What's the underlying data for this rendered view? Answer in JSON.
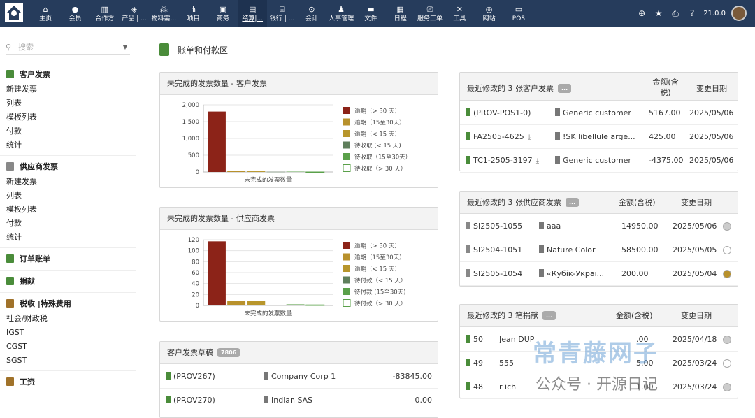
{
  "topnav": {
    "items": [
      {
        "label": "主页",
        "icon": "home-icon",
        "glyph": "⌂"
      },
      {
        "label": "会员",
        "icon": "user-icon",
        "glyph": "●"
      },
      {
        "label": "合作方",
        "icon": "building-icon",
        "glyph": "▥"
      },
      {
        "label": "产品 | ...",
        "icon": "cube-icon",
        "glyph": "◈"
      },
      {
        "label": "物料需...",
        "icon": "cubes-icon",
        "glyph": "⁂"
      },
      {
        "label": "项目",
        "icon": "project-icon",
        "glyph": "⋔"
      },
      {
        "label": "商务",
        "icon": "briefcase-icon",
        "glyph": "▣"
      },
      {
        "label": "结算|...",
        "icon": "invoice-icon",
        "glyph": "▤"
      },
      {
        "label": "银行 | ...",
        "icon": "bank-icon",
        "glyph": "⌸"
      },
      {
        "label": "会计",
        "icon": "search-money-icon",
        "glyph": "⊙"
      },
      {
        "label": "人事管理",
        "icon": "people-icon",
        "glyph": "♟"
      },
      {
        "label": "文件",
        "icon": "folder-icon",
        "glyph": "▬"
      },
      {
        "label": "日程",
        "icon": "calendar-icon",
        "glyph": "▦"
      },
      {
        "label": "服务工单",
        "icon": "ticket-icon",
        "glyph": "⎚"
      },
      {
        "label": "工具",
        "icon": "tools-icon",
        "glyph": "✕"
      },
      {
        "label": "网站",
        "icon": "globe-icon",
        "glyph": "◎"
      },
      {
        "label": "POS",
        "icon": "pos-icon",
        "glyph": "▭"
      }
    ],
    "version": "21.0.0"
  },
  "sidebar": {
    "search_placeholder": "搜索",
    "customer_invoices": {
      "title": "客户发票",
      "items": [
        "新建发票",
        "列表",
        "模板列表",
        "付款",
        "统计"
      ]
    },
    "supplier_invoices": {
      "title": "供应商发票",
      "items": [
        "新建发票",
        "列表",
        "模板列表",
        "付款",
        "统计"
      ]
    },
    "order_billing": "订单账单",
    "donations": "捐献",
    "tax": {
      "title": "税收 |特殊费用",
      "items": [
        "社会/财政税",
        "IGST",
        "CGST",
        "SGST"
      ]
    },
    "salary": "工资"
  },
  "page": {
    "title": "账单和付款区"
  },
  "customer_chart": {
    "title": "未完成的发票数量 - 客户发票",
    "xlabel": "未完成的发票数量",
    "ticks": [
      "2,000",
      "1,500",
      "1,000",
      "500",
      "0"
    ],
    "legend": [
      "逾期（> 30 天）",
      "逾期（15至30天）",
      "逾期（< 15 天）",
      "待收取 (< 15 天)",
      "待收取（15至30天）",
      "待收取（> 30 天）"
    ]
  },
  "supplier_chart": {
    "title": "未完成的发票数量 - 供应商发票",
    "xlabel": "未完成的发票数量",
    "ticks": [
      "120",
      "100",
      "80",
      "60",
      "40",
      "20",
      "0"
    ],
    "legend": [
      "逾期（> 30 天）",
      "逾期（15至30天）",
      "逾期（< 15 天）",
      "待付款（< 15 天）",
      "待付款 (15至30天)",
      "待付款（> 30 天）"
    ]
  },
  "chart_data": [
    {
      "type": "bar",
      "title": "未完成的发票数量 - 客户发票",
      "xlabel": "未完成的发票数量",
      "ylim": [
        0,
        2000
      ],
      "categories": [
        "逾期（> 30 天）",
        "逾期（15至30天）",
        "逾期（< 15 天）",
        "待收取 (< 15 天)",
        "待收取（15至30天）",
        "待收取（> 30 天）"
      ],
      "values": [
        1800,
        25,
        20,
        5,
        10,
        0
      ],
      "colors": [
        "#8c2318",
        "#b8912c",
        "#b8962c",
        "#5f7f5c",
        "#5aa04a",
        "#ffffff"
      ]
    },
    {
      "type": "bar",
      "title": "未完成的发票数量 - 供应商发票",
      "xlabel": "未完成的发票数量",
      "ylim": [
        0,
        120
      ],
      "categories": [
        "逾期（> 30 天）",
        "逾期（15至30天）",
        "逾期（< 15 天）",
        "待付款（< 15 天）",
        "待付款 (15至30天)",
        "待付款（> 30 天）"
      ],
      "values": [
        117,
        8,
        8,
        1,
        2,
        1
      ],
      "colors": [
        "#8c2318",
        "#b8912c",
        "#b8962c",
        "#5f7f5c",
        "#5aa04a",
        "#ffffff"
      ]
    }
  ],
  "drafts": {
    "title": "客户发票草稿",
    "count": "7806",
    "rows": [
      {
        "ref": "(PROV267)",
        "company": "Company Corp 1",
        "amount": "-83845.00"
      },
      {
        "ref": "(PROV270)",
        "company": "Indian SAS",
        "amount": "0.00"
      }
    ]
  },
  "last_customer": {
    "title": "最近修改的 3 张客户发票",
    "more": "...",
    "col_amount": "金额(含税)",
    "col_amount_2": "税)",
    "col_date": "变更日期",
    "rows": [
      {
        "ref": "(PROV-POS1-0)",
        "company": "Generic customer",
        "amount": "5167.00",
        "date": "2025/05/06"
      },
      {
        "ref": "FA2505-4625",
        "company": "!SK libellule arge...",
        "amount": "425.00",
        "date": "2025/05/06"
      },
      {
        "ref": "TC1-2505-3197",
        "company": "Generic customer",
        "amount": "-4375.00",
        "date": "2025/05/06"
      }
    ]
  },
  "last_supplier": {
    "title": "最近修改的 3 张供应商发票",
    "more": "...",
    "col_amount": "金额(含税)",
    "col_date": "变更日期",
    "rows": [
      {
        "ref": "SI2505-1055",
        "company": "aaa",
        "amount": "14950.00",
        "date": "2025/05/06",
        "status_color": "#cccccc"
      },
      {
        "ref": "SI2504-1051",
        "company": "Nature Color",
        "amount": "58500.00",
        "date": "2025/05/05",
        "status_color": "#ffffff"
      },
      {
        "ref": "SI2505-1054",
        "company": "«Кубік-Украї...",
        "amount": "200.00",
        "date": "2025/05/04",
        "status_color": "#b8912c"
      }
    ]
  },
  "last_donations": {
    "title": "最近修改的 3 笔捐献",
    "more": "...",
    "col_amount": "金额(含税)",
    "col_date": "变更日期",
    "rows": [
      {
        "ref": "50",
        "name": "Jean DUP",
        "amount": ".00",
        "date": "2025/04/18",
        "status_color": "#cccccc"
      },
      {
        "ref": "49",
        "name": "555",
        "amount": "5.00",
        "date": "2025/03/24",
        "status_color": "#ffffff"
      },
      {
        "ref": "48",
        "name": "r ich",
        "amount": "1.00",
        "date": "2025/03/24",
        "status_color": "#cccccc"
      }
    ]
  },
  "watermark": {
    "text": "常青藤网子",
    "sub": "公众号 · 开源日记"
  }
}
